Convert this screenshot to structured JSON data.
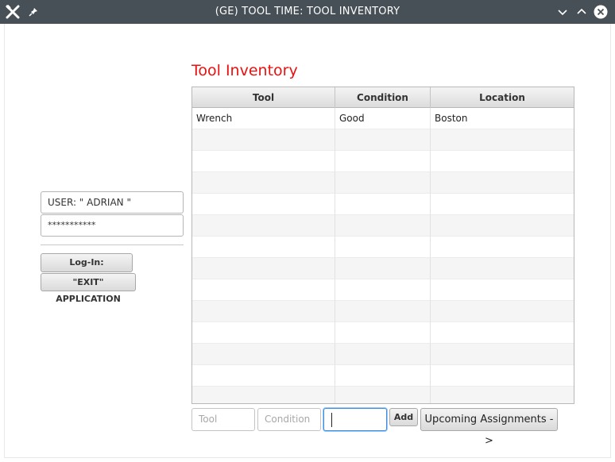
{
  "window": {
    "title": "(GE) TOOL TIME: TOOL INVENTORY"
  },
  "heading": "Tool Inventory",
  "table": {
    "columns": [
      "Tool",
      "Condition",
      "Location"
    ],
    "rows": [
      [
        "Wrench",
        "Good",
        "Boston"
      ],
      [
        "",
        "",
        ""
      ],
      [
        "",
        "",
        ""
      ],
      [
        "",
        "",
        ""
      ],
      [
        "",
        "",
        ""
      ],
      [
        "",
        "",
        ""
      ],
      [
        "",
        "",
        ""
      ],
      [
        "",
        "",
        ""
      ],
      [
        "",
        "",
        ""
      ],
      [
        "",
        "",
        ""
      ],
      [
        "",
        "",
        ""
      ],
      [
        "",
        "",
        ""
      ],
      [
        "",
        "",
        ""
      ],
      [
        "",
        "",
        ""
      ]
    ]
  },
  "login": {
    "user_value": "USER:  \" ADRIAN \"",
    "password_value": "***********",
    "login_label": "Log-In: Application",
    "exit_label": "\"EXIT\" APPLICATION"
  },
  "add_row": {
    "tool_placeholder": "Tool",
    "condition_placeholder": "Condition",
    "location_value": "",
    "add_label": "Add",
    "upcoming_label": "Upcoming Assignments - >"
  },
  "colors": {
    "titlebar": "#475057",
    "heading": "#e8110f",
    "focus": "#3d8ee0"
  },
  "icons": [
    "tools-icon",
    "pin-icon",
    "minimize-icon",
    "maximize-icon",
    "close-icon"
  ]
}
